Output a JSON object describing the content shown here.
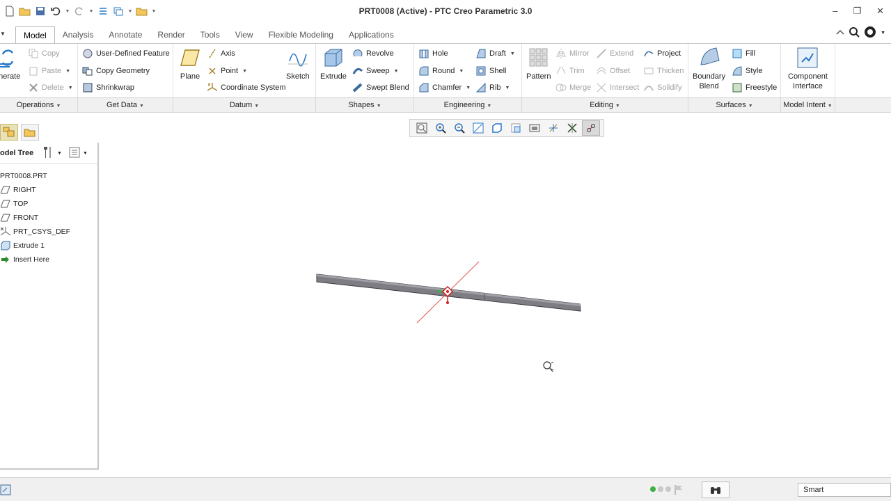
{
  "window": {
    "title": "PRT0008 (Active) - PTC Creo Parametric 3.0"
  },
  "tabs": [
    "Model",
    "Analysis",
    "Annotate",
    "Render",
    "Tools",
    "View",
    "Flexible Modeling",
    "Applications"
  ],
  "ribbon": {
    "operations": {
      "regenerate": "enerate",
      "copy": "Copy",
      "paste": "Paste",
      "delete": "Delete"
    },
    "get_data": {
      "udf": "User-Defined Feature",
      "copy_geometry": "Copy Geometry",
      "shrinkwrap": "Shrinkwrap"
    },
    "datum": {
      "plane": "Plane",
      "axis": "Axis",
      "point": "Point",
      "csys": "Coordinate System",
      "sketch": "Sketch"
    },
    "shapes": {
      "extrude": "Extrude",
      "revolve": "Revolve",
      "sweep": "Sweep",
      "swept_blend": "Swept Blend"
    },
    "engineering": {
      "hole": "Hole",
      "round": "Round",
      "chamfer": "Chamfer",
      "draft": "Draft",
      "shell": "Shell",
      "rib": "Rib"
    },
    "editing": {
      "pattern": "Pattern",
      "mirror": "Mirror",
      "trim": "Trim",
      "merge": "Merge",
      "extend": "Extend",
      "offset": "Offset",
      "intersect": "Intersect",
      "project": "Project",
      "thicken": "Thicken",
      "solidify": "Solidify"
    },
    "surfaces": {
      "boundary_blend_1": "Boundary",
      "boundary_blend_2": "Blend",
      "fill": "Fill",
      "style": "Style",
      "freestyle": "Freestyle"
    },
    "model_intent": {
      "component_interface_1": "Component",
      "component_interface_2": "Interface"
    }
  },
  "group_labels": [
    "Operations",
    "Get Data",
    "Datum",
    "Shapes",
    "Engineering",
    "Editing",
    "Surfaces",
    "Model Intent"
  ],
  "model_tree": {
    "title": "odel Tree",
    "items": [
      "PRT0008.PRT",
      "RIGHT",
      "TOP",
      "FRONT",
      "PRT_CSYS_DEF",
      "Extrude 1",
      "Insert Here"
    ]
  },
  "status": {
    "filter": "Smart"
  },
  "colors": {
    "accent_blue": "#2a78c8",
    "status_green": "#3cb043",
    "part_grey": "#7d7d83"
  }
}
